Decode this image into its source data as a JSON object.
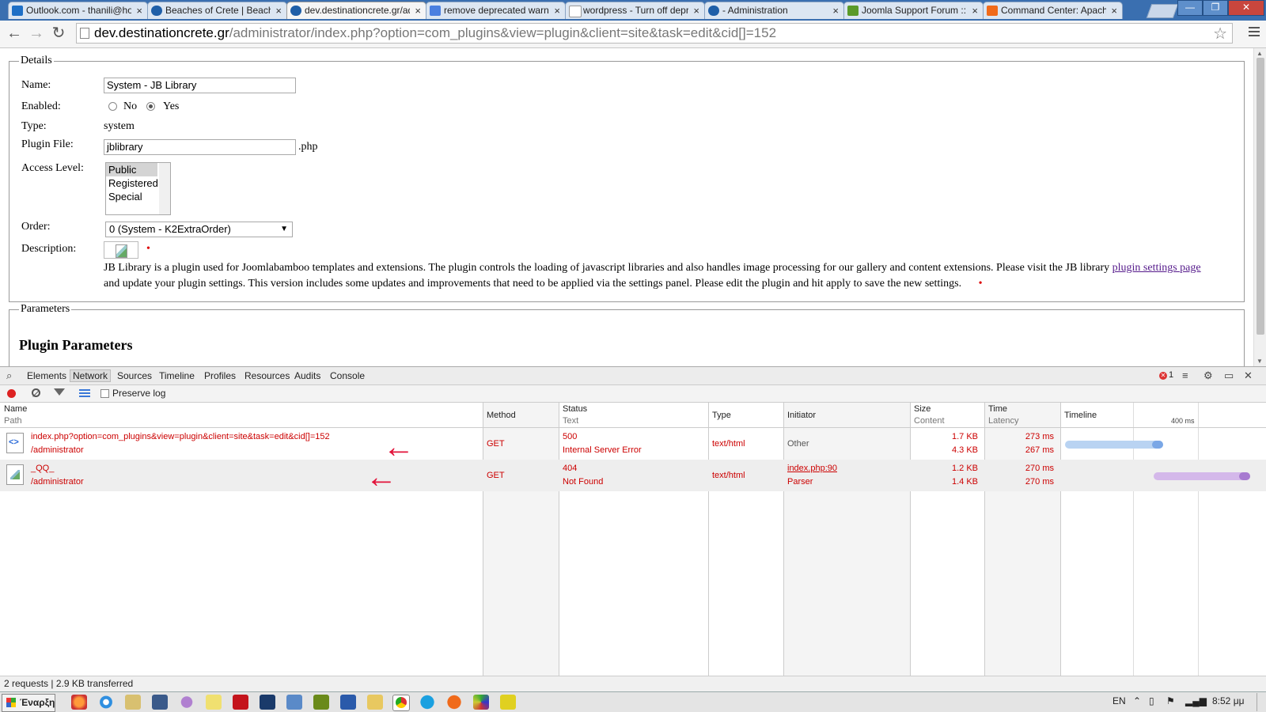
{
  "browser": {
    "tabs": [
      {
        "title": "Outlook.com - thanili@hotmail",
        "icon": "outlook-icon",
        "color": "#1e6fc6"
      },
      {
        "title": "Beaches of Crete | Beaches",
        "icon": "site-icon",
        "color": "#1f5fa8"
      },
      {
        "title": "dev.destinationcrete.gr/admin",
        "icon": "site-icon",
        "color": "#1f5fa8"
      },
      {
        "title": "remove deprecated warnings",
        "icon": "google-icon",
        "color": "#4a7fe0"
      },
      {
        "title": "wordpress - Turn off deprecated",
        "icon": "page-icon",
        "color": "#9a9a9a"
      },
      {
        "title": "- Administration",
        "icon": "site-icon",
        "color": "#1f5fa8"
      },
      {
        "title": "Joomla Support Forum :: Nav",
        "icon": "joomla-icon",
        "color": "#5a9a2a"
      },
      {
        "title": "Command Center: Apache",
        "icon": "blogger-icon",
        "color": "#f06a1a"
      }
    ],
    "close_glyph": "×",
    "window_buttons": {
      "minimize": "—",
      "maximize": "❐",
      "close": "✕"
    },
    "url_host": "dev.destinationcrete.gr",
    "url_path": "/administrator/index.php?option=com_plugins&view=plugin&client=site&task=edit&cid[]=152"
  },
  "form": {
    "details_legend": "Details",
    "name_label": "Name:",
    "name_value": "System - JB Library",
    "enabled_label": "Enabled:",
    "enabled_no": "No",
    "enabled_yes": "Yes",
    "type_label": "Type:",
    "type_value": "system",
    "plugin_file_label": "Plugin File:",
    "plugin_file_value": "jblibrary",
    "plugin_file_ext": ".php",
    "access_label": "Access Level:",
    "access_options": [
      "Public",
      "Registered",
      "Special"
    ],
    "order_label": "Order:",
    "order_value": "0 (System - K2ExtraOrder)",
    "description_label": "Description:",
    "required_mark": "•",
    "description_text_1": "JB Library is a plugin used for Joomlabamboo templates and extensions. The plugin controls the loading of javascript libraries and also handles image processing for our gallery and content extensions. Please visit the JB library ",
    "description_link": "plugin settings page",
    "description_text_2": " and update your plugin settings. This version includes some updates and improvements that need to be applied via the settings panel. Please edit the plugin and hit apply to save the new settings.",
    "parameters_legend": "Parameters",
    "plugin_parameters_heading": "Plugin Parameters"
  },
  "devtools": {
    "tabs": [
      "Elements",
      "Network",
      "Sources",
      "Timeline",
      "Profiles",
      "Resources",
      "Audits",
      "Console"
    ],
    "active_tab": "Network",
    "error_count": "1",
    "preserve_log": "Preserve log",
    "columns": {
      "name": "Name",
      "path": "Path",
      "method": "Method",
      "status": "Status",
      "text": "Text",
      "type": "Type",
      "initiator": "Initiator",
      "size": "Size",
      "content": "Content",
      "time": "Time",
      "latency": "Latency",
      "timeline": "Timeline",
      "timeline_tick": "400 ms"
    },
    "requests": [
      {
        "name": "index.php?option=com_plugins&view=plugin&client=site&task=edit&cid[]=152",
        "path": "/administrator",
        "method": "GET",
        "status": "500",
        "status_text": "Internal Server Error",
        "type": "text/html",
        "initiator": "Other",
        "initiator_sub": "",
        "size": "1.7 KB",
        "content": "4.3 KB",
        "time": "273 ms",
        "latency": "267 ms",
        "bar_color": "#b9d3f2",
        "bar_end_color": "#7aa7e6"
      },
      {
        "name": "_QQ_",
        "path": "/administrator",
        "method": "GET",
        "status": "404",
        "status_text": "Not Found",
        "type": "text/html",
        "initiator": "index.php:90",
        "initiator_sub": "Parser",
        "size": "1.2 KB",
        "content": "1.4 KB",
        "time": "270 ms",
        "latency": "270 ms",
        "bar_color": "#d4b8ea",
        "bar_end_color": "#a77ad0"
      }
    ],
    "summary": "2 requests | 2.9 KB transferred",
    "annotation_color": "#e2133a"
  },
  "taskbar": {
    "start_label": "Έναρξη",
    "language": "EN",
    "clock": "8:52 μμ"
  }
}
